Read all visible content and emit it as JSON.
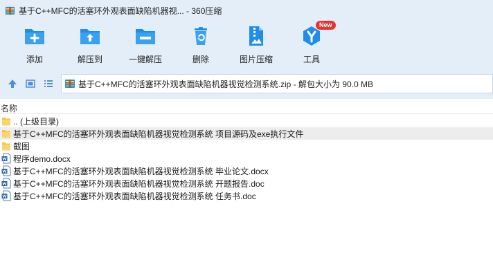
{
  "window": {
    "title": "基于C++MFC的活塞环外观表面缺陷机器视... - 360压缩",
    "app_icon": "360-zip-app-icon"
  },
  "toolbar": {
    "items": [
      {
        "label": "添加",
        "icon": "folder-add-icon"
      },
      {
        "label": "解压到",
        "icon": "folder-extract-icon"
      },
      {
        "label": "一键解压",
        "icon": "folder-oneclick-icon"
      },
      {
        "label": "删除",
        "icon": "recycle-bin-icon"
      },
      {
        "label": "图片压缩",
        "icon": "image-zip-icon"
      },
      {
        "label": "工具",
        "icon": "tools-y-icon",
        "badge": "New"
      }
    ]
  },
  "navigation": {
    "up_icon": "up-arrow-icon",
    "thumbnail_view_icon": "thumbnail-view-icon",
    "list_view_icon": "list-view-icon",
    "path_text": "基于C++MFC的活塞环外观表面缺陷机器视觉检测系统.zip - 解包大小为 90.0 MB"
  },
  "file_list": {
    "column_name": "名称",
    "items": [
      {
        "name": ".. (上级目录)",
        "type": "folder-up"
      },
      {
        "name": "基于C++MFC的活塞环外观表面缺陷机器视觉检测系统 项目源码及exe执行文件",
        "type": "folder"
      },
      {
        "name": "截图",
        "type": "folder"
      },
      {
        "name": "程序demo.docx",
        "type": "word"
      },
      {
        "name": "基于C++MFC的活塞环外观表面缺陷机器视觉检测系统 毕业论文.docx",
        "type": "word"
      },
      {
        "name": "基于C++MFC的活塞环外观表面缺陷机器视觉检测系统 开题报告.doc",
        "type": "word"
      },
      {
        "name": "基于C++MFC的活塞环外观表面缺陷机器视觉检测系统 任务书.doc",
        "type": "word"
      }
    ]
  },
  "colors": {
    "toolbar_bg": "#e4eef8",
    "icon_blue": "#1f8ee8",
    "folder_yellow": "#f5c342",
    "badge_red": "#e8322e"
  }
}
